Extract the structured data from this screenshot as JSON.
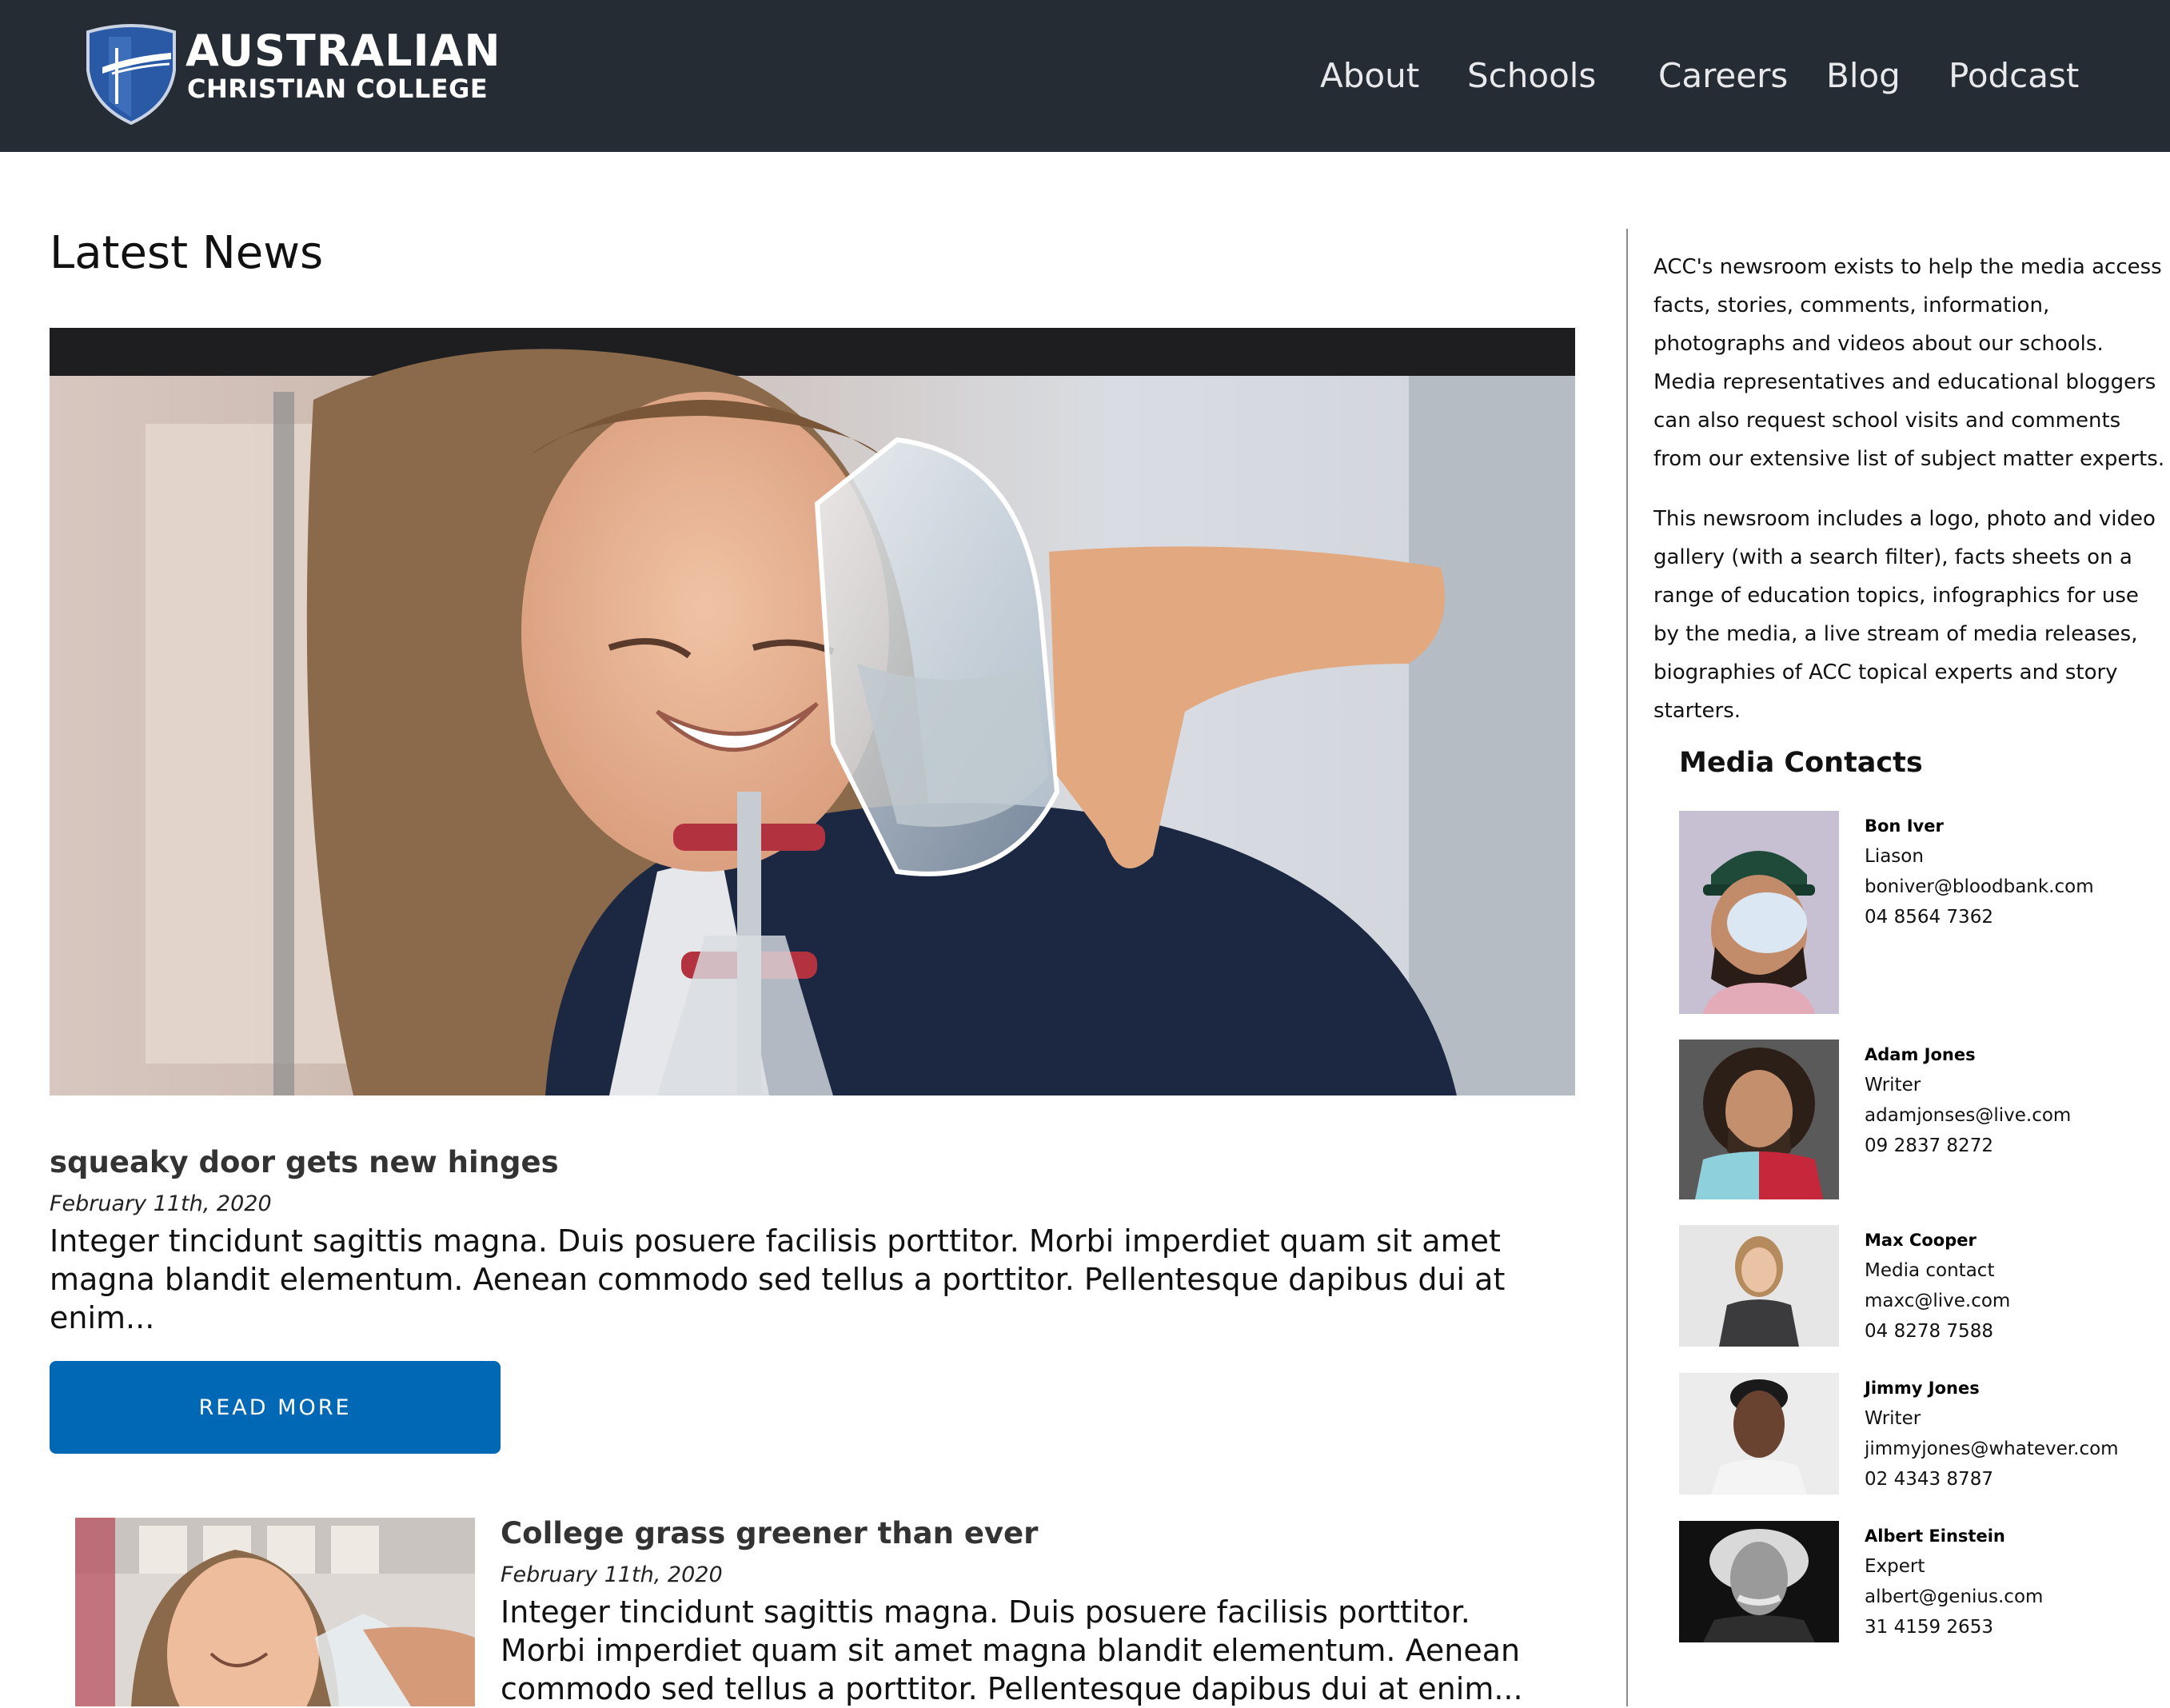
{
  "header": {
    "logo_line1": "AUSTRALIAN",
    "logo_line2": "CHRISTIAN COLLEGE",
    "nav": [
      "About",
      "Schools",
      "Careers",
      "Blog",
      "Podcast"
    ]
  },
  "main": {
    "page_title": "Latest News",
    "featured": {
      "title": "squeaky door gets new hinges",
      "date": "February 11th, 2020",
      "excerpt": "Integer tincidunt sagittis magna. Duis posuere facilisis porttitor. Morbi imperdiet quam sit amet magna blandit elementum. Aenean commodo sed tellus a porttitor. Pellentesque dapibus dui at enim...",
      "button": "READ MORE"
    },
    "second": {
      "title": "College grass greener than ever",
      "date": "February 11th, 2020",
      "excerpt": "Integer tincidunt sagittis magna. Duis posuere facilisis porttitor. Morbi imperdiet quam sit amet magna blandit elementum. Aenean commodo sed tellus a porttitor. Pellentesque dapibus dui at enim..."
    }
  },
  "sidebar": {
    "intro1": "ACC's newsroom exists to help the media access facts, stories, comments, information, photographs and videos about our schools. Media representatives and educational bloggers can also request school visits and comments from our extensive list of subject matter experts.",
    "intro2": "This newsroom includes a logo, photo and video gallery (with a search filter), facts sheets on a range of education topics, infographics for use by the media, a live stream of media releases, biographies of ACC topical experts and story starters.",
    "media_contacts_title": "Media Contacts",
    "contacts": [
      {
        "name": "Bon Iver",
        "role": "Liason",
        "email": "boniver@bloodbank.com",
        "phone": "04 8564 7362"
      },
      {
        "name": "Adam Jones",
        "role": "Writer",
        "email": "adamjonses@live.com",
        "phone": "09 2837 8272"
      },
      {
        "name": "Max Cooper",
        "role": "Media contact",
        "email": "maxc@live.com",
        "phone": "04 8278 7588"
      },
      {
        "name": "Jimmy Jones",
        "role": "Writer",
        "email": "jimmyjones@whatever.com",
        "phone": "02 4343 8787"
      },
      {
        "name": "Albert Einstein",
        "role": "Expert",
        "email": "albert@genius.com",
        "phone": "31 4159 2653"
      }
    ]
  }
}
